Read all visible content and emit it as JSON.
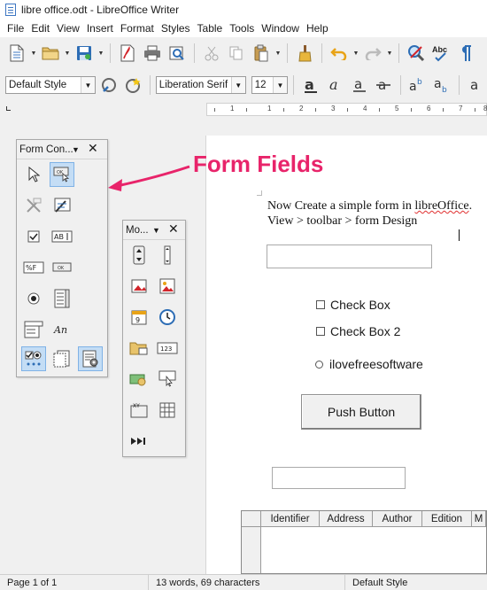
{
  "window": {
    "title": "libre office.odt - LibreOffice Writer"
  },
  "menu": [
    "File",
    "Edit",
    "View",
    "Insert",
    "Format",
    "Styles",
    "Table",
    "Tools",
    "Window",
    "Help"
  ],
  "toolbar2": {
    "paragraph_style": "Default Style",
    "font_name": "Liberation Serif",
    "font_size": "12"
  },
  "ruler_numbers": [
    "1",
    "1",
    "2",
    "3",
    "4",
    "5",
    "6",
    "7",
    "8"
  ],
  "form_controls": {
    "title": "Form Con..."
  },
  "more_controls": {
    "title": "Mo..."
  },
  "annotation": {
    "text": "Form Fields",
    "color": "#e8246a"
  },
  "document": {
    "line1_prefix": "Now Create a simple form in ",
    "line1_word": "libreOffice",
    "line1_suffix": ".",
    "line2": "View > toolbar > form Design",
    "checkbox1": "Check Box",
    "checkbox2": "Check Box 2",
    "radio1": "ilovefreesoftware",
    "push_button": "Push Button",
    "table_headers": [
      "Identifier",
      "Address",
      "Author",
      "Edition",
      "M"
    ]
  },
  "status": {
    "page": "Page 1 of 1",
    "words": "13 words, 69 characters",
    "style": "Default Style"
  },
  "colors": {
    "accent_blue": "#3e77c2",
    "active_bg": "#c4ddf5"
  }
}
